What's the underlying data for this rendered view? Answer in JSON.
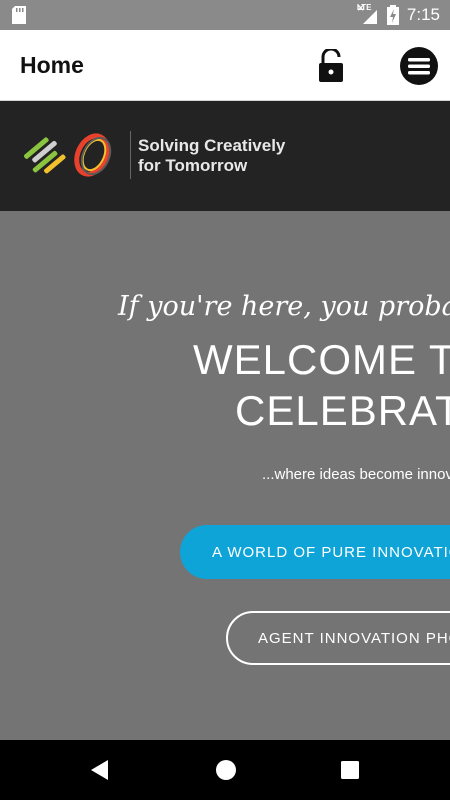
{
  "status_bar": {
    "time": "7:15",
    "network_label": "LTE",
    "icons": [
      "sd-card-icon",
      "lte-signal-icon",
      "battery-charging-icon"
    ]
  },
  "app_bar": {
    "title": "Home",
    "icons": [
      "unlock-icon",
      "menu-icon"
    ]
  },
  "brand": {
    "tagline_line1": "Solving Creatively",
    "tagline_line2": "for Tomorrow",
    "logo_colors": [
      "#8bc53f",
      "#cfcfcf",
      "#f2c12e",
      "#e8412c",
      "#5a5a5a"
    ]
  },
  "hero": {
    "lead": "If you're here, you probably c",
    "heading_line1": "WELCOME TO",
    "heading_line2": "CELEBRATI",
    "subheading": "...where ideas become innov",
    "primary_button": "A WORLD OF PURE INNOVATIO",
    "secondary_button": "AGENT INNOVATION PHO"
  },
  "nav_bar": {
    "icons": [
      "back-icon",
      "home-icon",
      "recent-apps-icon"
    ]
  },
  "colors": {
    "accent": "#0ea4d8",
    "brand_bar": "#232323",
    "hero_bg": "#747474",
    "status_bar": "#8a8a8a"
  }
}
